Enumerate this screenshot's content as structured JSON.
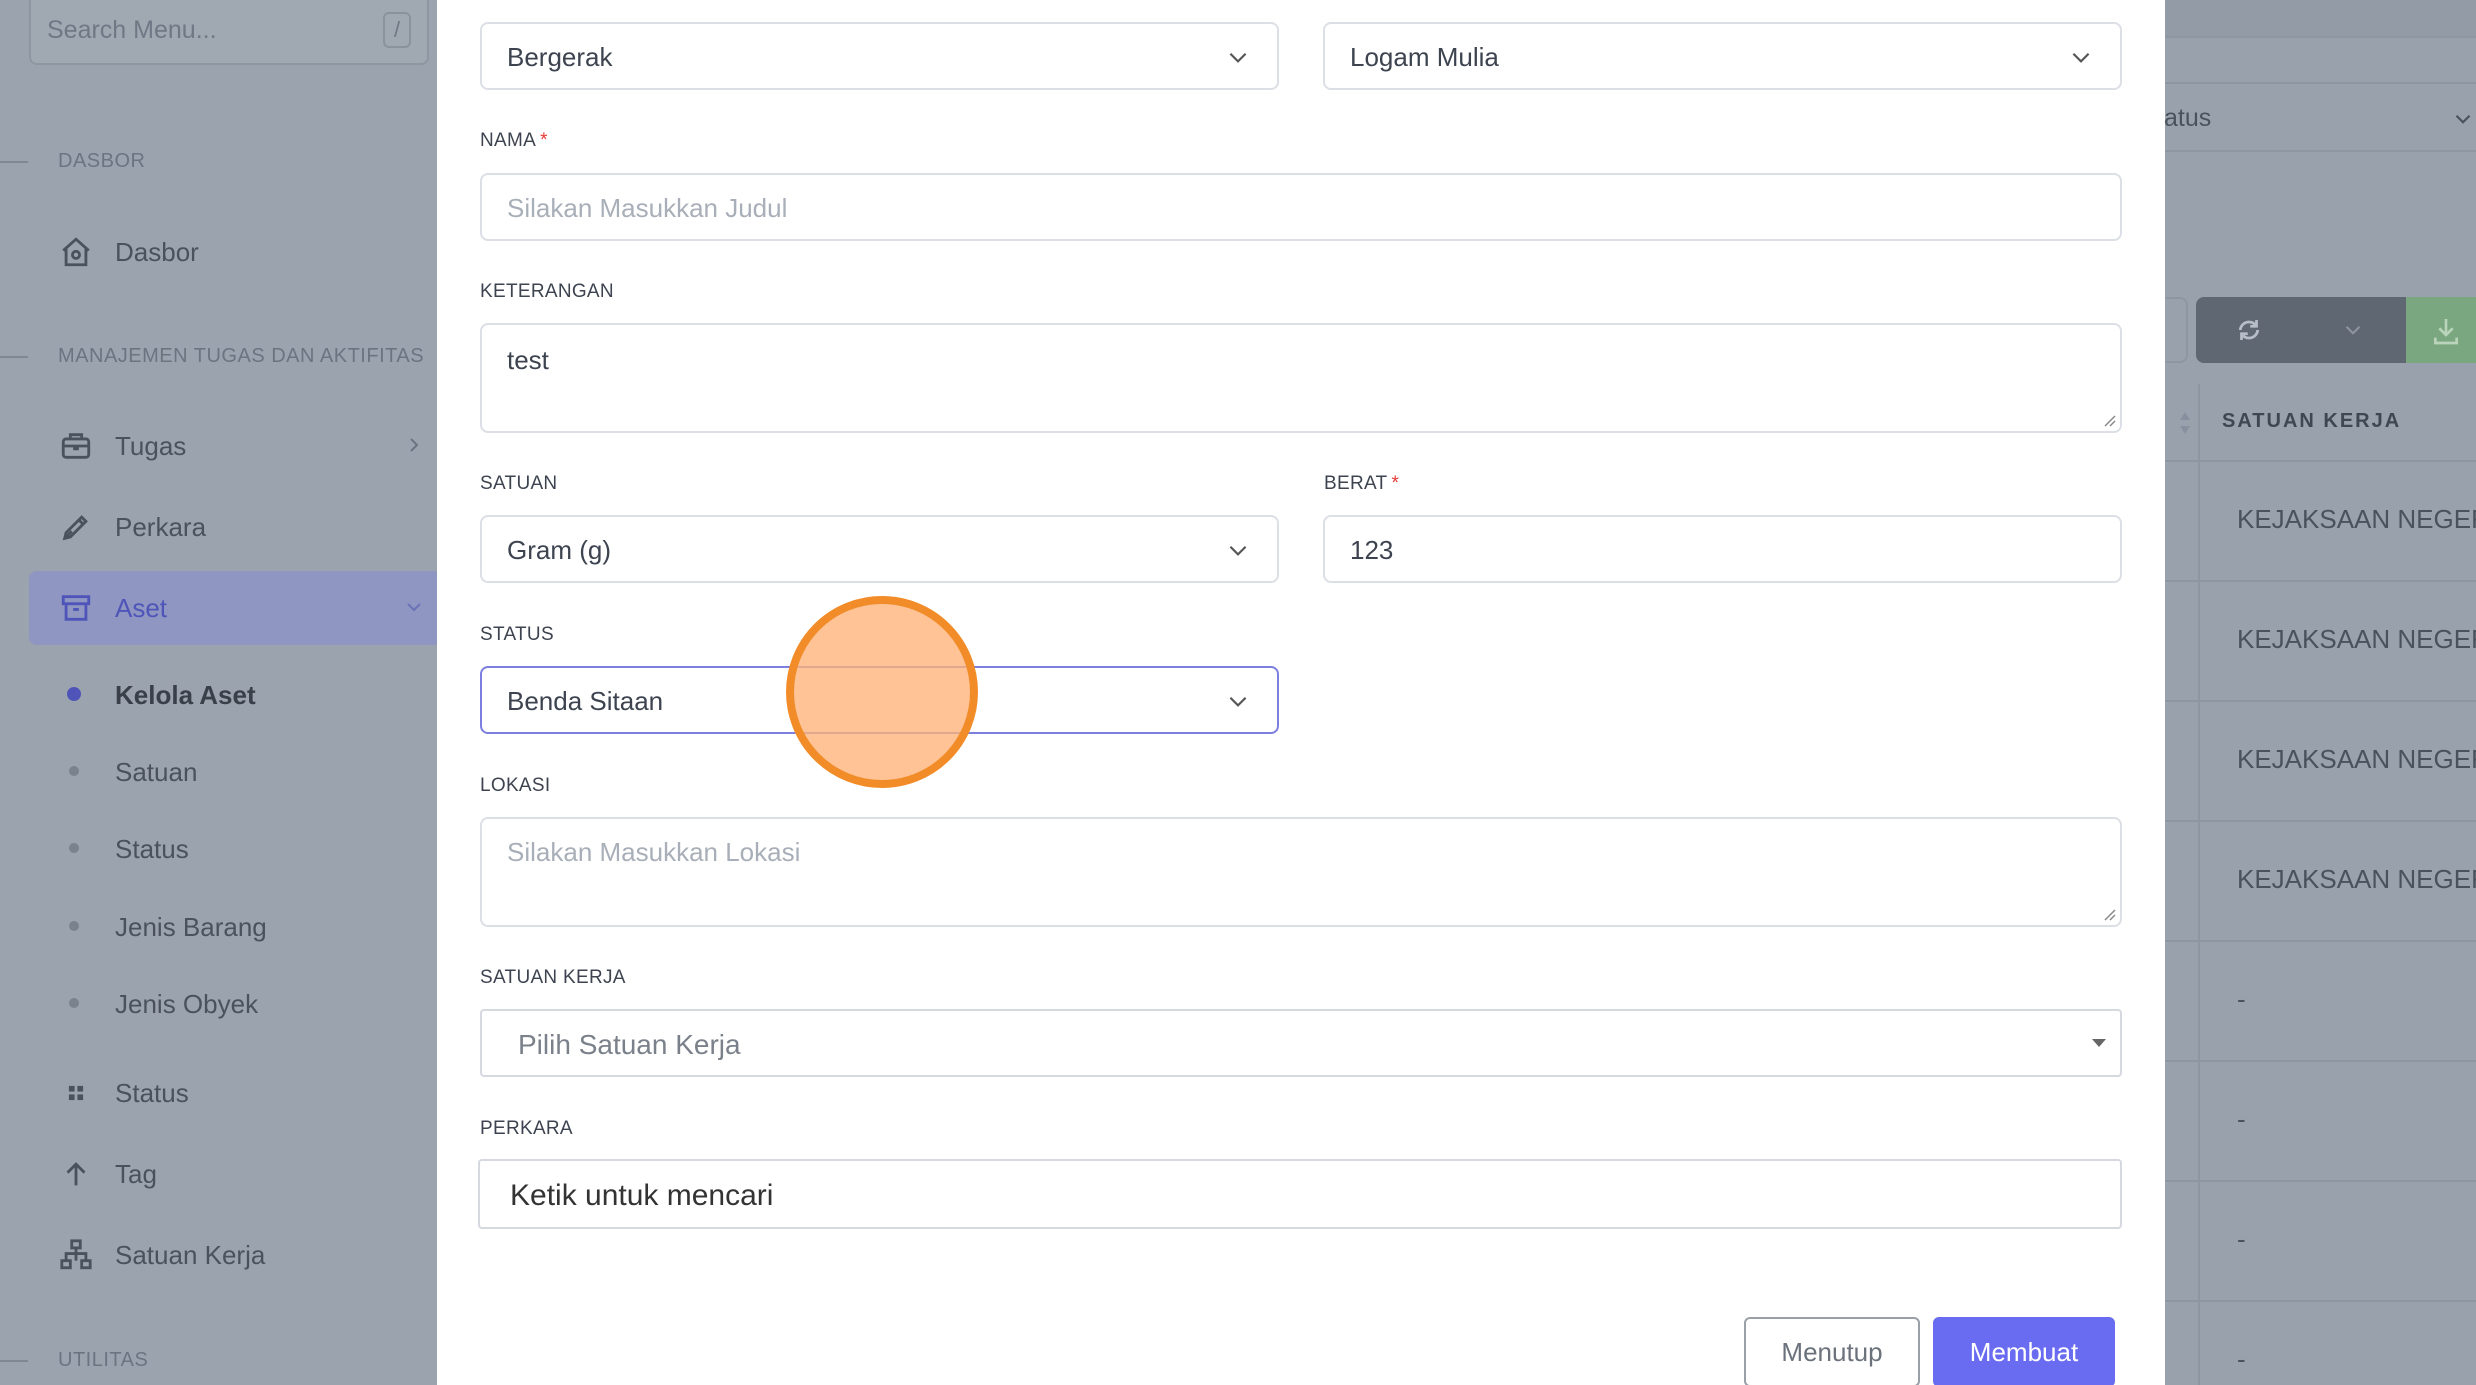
{
  "sidebar": {
    "search_placeholder": "Search Menu...",
    "search_shortcut": "/",
    "sections": [
      {
        "label": "DASBOR"
      },
      {
        "label": "MANAJEMEN TUGAS DAN AKTIFITAS"
      },
      {
        "label": "UTILITAS"
      }
    ],
    "dasbor_label": "Dasbor",
    "items": [
      {
        "label": "Tugas",
        "icon": "briefcase-icon"
      },
      {
        "label": "Perkara",
        "icon": "pen-icon"
      },
      {
        "label": "Aset",
        "icon": "archive-icon"
      }
    ],
    "aset_sub": [
      {
        "label": "Kelola Aset"
      },
      {
        "label": "Satuan"
      },
      {
        "label": "Status"
      },
      {
        "label": "Jenis Barang"
      },
      {
        "label": "Jenis Obyek"
      }
    ],
    "items2": [
      {
        "label": "Status",
        "icon": "grid-icon"
      },
      {
        "label": "Tag",
        "icon": "arrow-up-icon"
      },
      {
        "label": "Satuan Kerja",
        "icon": "sitemap-icon"
      }
    ]
  },
  "background_table": {
    "filter_label": "atus",
    "column_header": "SATUAN KERJA",
    "rows": [
      "KEJAKSAAN NEGERI S",
      "KEJAKSAAN NEGERI S",
      "KEJAKSAAN NEGERI S",
      "KEJAKSAAN NEGERI S",
      "-",
      "-",
      "-",
      "-"
    ]
  },
  "form": {
    "jenis_barang_value": "Bergerak",
    "jenis_obyek_value": "Logam Mulia",
    "nama": {
      "label": "NAMA",
      "required": "*",
      "placeholder": "Silakan Masukkan Judul"
    },
    "keterangan": {
      "label": "KETERANGAN",
      "value": "test"
    },
    "satuan": {
      "label": "SATUAN",
      "value": "Gram (g)"
    },
    "berat": {
      "label": "BERAT",
      "required": "*",
      "value": "123"
    },
    "status": {
      "label": "STATUS",
      "value": "Benda Sitaan"
    },
    "lokasi": {
      "label": "LOKASI",
      "placeholder": "Silakan Masukkan Lokasi"
    },
    "satuan_kerja": {
      "label": "SATUAN KERJA",
      "placeholder": "Pilih Satuan Kerja"
    },
    "perkara": {
      "label": "PERKARA",
      "placeholder": "Ketik untuk mencari"
    },
    "close_label": "Menutup",
    "submit_label": "Membuat"
  },
  "colors": {
    "primary": "#696cf0",
    "required": "#e53935",
    "click_marker": "#f28c28"
  }
}
